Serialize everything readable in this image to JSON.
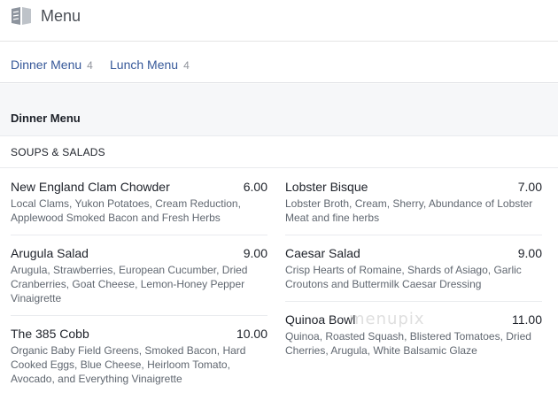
{
  "header": {
    "title": "Menu",
    "icon": "menu-book-icon"
  },
  "tabs": [
    {
      "label": "Dinner Menu",
      "count": "4"
    },
    {
      "label": "Lunch Menu",
      "count": "4"
    }
  ],
  "section": {
    "title": "Dinner Menu"
  },
  "category": {
    "title": "SOUPS & SALADS"
  },
  "items": [
    {
      "name": "New England Clam Chowder",
      "price": "6.00",
      "description": "Local Clams, Yukon Potatoes, Cream Reduction, Applewood Smoked Bacon and Fresh Herbs"
    },
    {
      "name": "Lobster Bisque",
      "price": "7.00",
      "description": "Lobster Broth, Cream, Sherry, Abundance of Lobster Meat and fine herbs"
    },
    {
      "name": "Arugula Salad",
      "price": "9.00",
      "description": "Arugula, Strawberries, European Cucumber, Dried Cranberries, Goat Cheese, Lemon-Honey Pepper Vinaigrette"
    },
    {
      "name": "Caesar Salad",
      "price": "9.00",
      "description": "Crisp Hearts of Romaine, Shards of Asiago, Garlic Croutons and Buttermilk Caesar Dressing"
    },
    {
      "name": "The 385 Cobb",
      "price": "10.00",
      "description": "Organic Baby Field Greens, Smoked Bacon, Hard Cooked Eggs, Blue Cheese, Heirloom Tomato, Avocado, and Everything Vinaigrette"
    },
    {
      "name": "Quinoa Bowl",
      "price": "11.00",
      "description": "Quinoa, Roasted Squash, Blistered Tomatoes, Dried Cherries, Arugula, White Balsamic Glaze"
    }
  ],
  "watermark": "menupix",
  "colors": {
    "link": "#365899",
    "muted": "#90949c",
    "band": "#f6f7f9"
  }
}
